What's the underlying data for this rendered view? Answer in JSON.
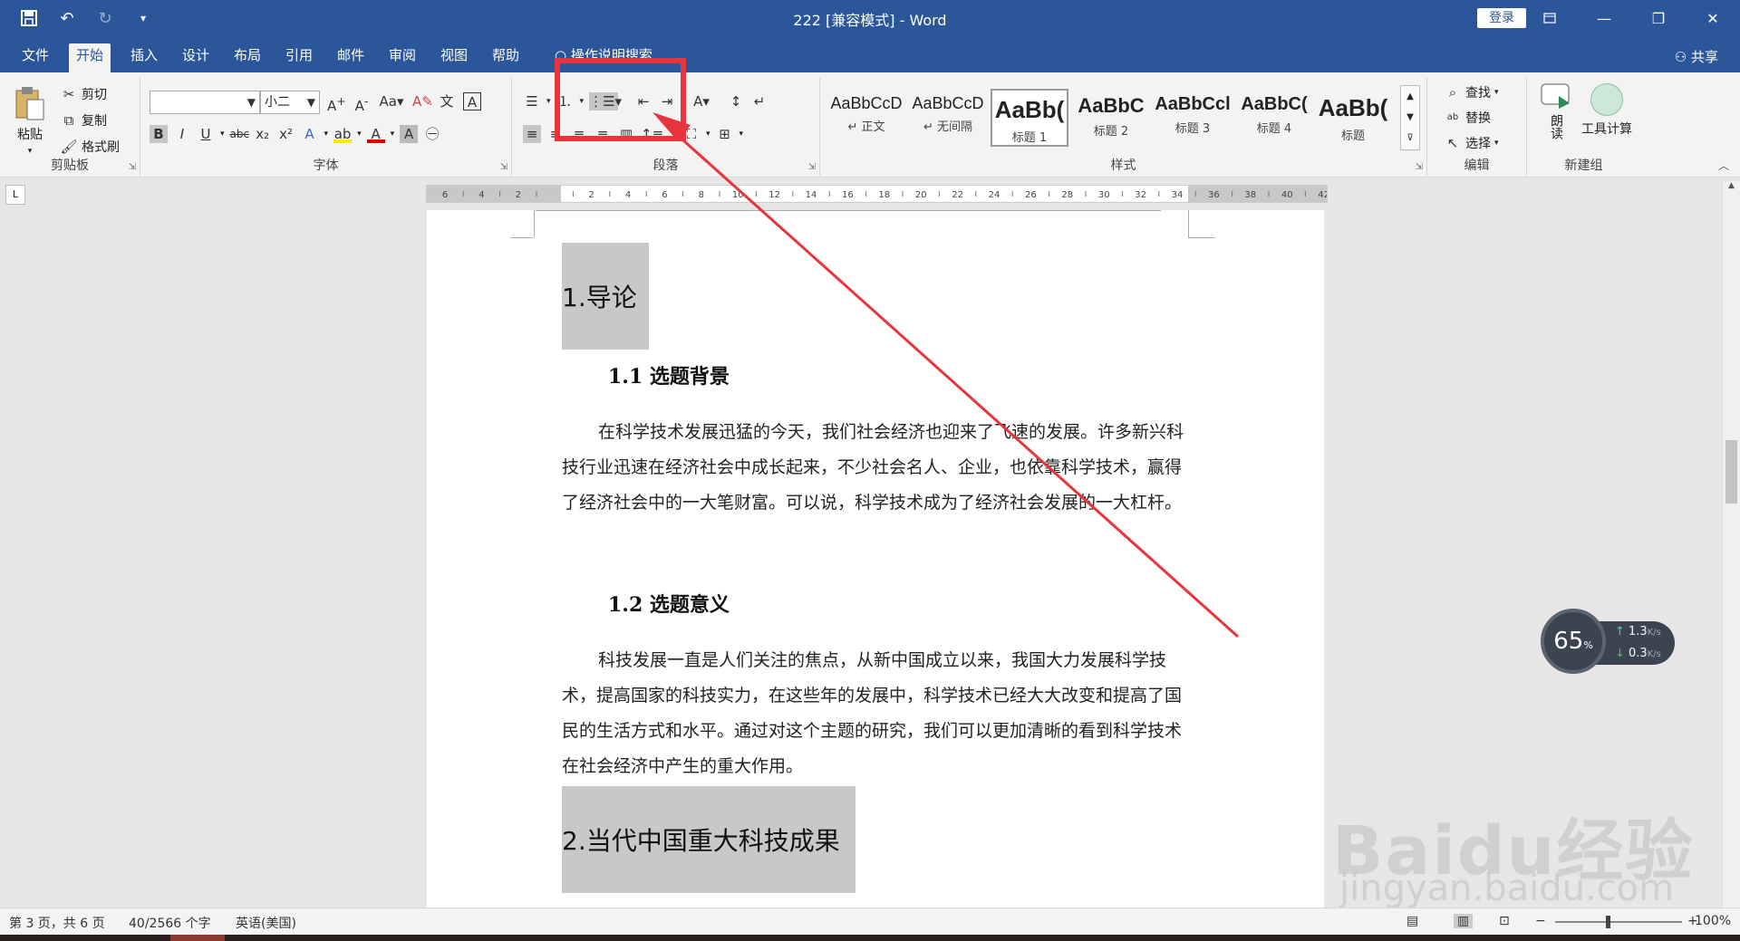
{
  "window": {
    "title": "222 [兼容模式]  -  Word",
    "login_label": "登录",
    "controls": [
      "restore-ribbon-icon",
      "minimize-icon",
      "maximize-icon",
      "close-icon"
    ]
  },
  "tabs": [
    {
      "label": "文件"
    },
    {
      "label": "开始",
      "active": true
    },
    {
      "label": "插入"
    },
    {
      "label": "设计"
    },
    {
      "label": "布局"
    },
    {
      "label": "引用"
    },
    {
      "label": "邮件"
    },
    {
      "label": "审阅"
    },
    {
      "label": "视图"
    },
    {
      "label": "帮助"
    },
    {
      "label": "操作说明搜索"
    }
  ],
  "share_label": "共享",
  "clipboard": {
    "label": "剪贴板",
    "paste": "粘贴",
    "cut": "剪切",
    "copy": "复制",
    "format_painter": "格式刷"
  },
  "font": {
    "label": "字体",
    "font_name": "",
    "font_size": "小二"
  },
  "paragraph": {
    "label": "段落"
  },
  "styles": {
    "label": "样式",
    "items": [
      {
        "sample": "AaBbCcD",
        "name": "↵ 正文"
      },
      {
        "sample": "AaBbCcD",
        "name": "↵ 无间隔"
      },
      {
        "sample": "AaBb(",
        "name": "标题 1",
        "selected": true
      },
      {
        "sample": "AaBbC",
        "name": "标题 2"
      },
      {
        "sample": "AaBbCcl",
        "name": "标题 3"
      },
      {
        "sample": "AaBbC(",
        "name": "标题 4"
      },
      {
        "sample": "AaBb(",
        "name": "标题"
      }
    ]
  },
  "editing": {
    "label": "编辑",
    "find": "查找",
    "replace": "替换",
    "select": "选择"
  },
  "new_group": {
    "label": "新建组",
    "read": "朗读",
    "tool": "工具计算"
  },
  "ruler": {
    "labels": [
      "6",
      "4",
      "2",
      "",
      "2",
      "4",
      "6",
      "8",
      "10",
      "12",
      "14",
      "16",
      "18",
      "20",
      "22",
      "24",
      "26",
      "28",
      "30",
      "32",
      "34",
      "36",
      "38",
      "40",
      "42"
    ]
  },
  "document": {
    "h1_a": "1.导论",
    "h2_a": "1.1 选题背景",
    "p1": "在科学技术发展迅猛的今天，我们社会经济也迎来了飞速的发展。许多新兴科技行业迅速在经济社会中成长起来，不少社会名人、企业，也依靠科学技术，赢得了经济社会中的一大笔财富。可以说，科学技术成为了经济社会发展的一大杠杆。",
    "h2_b": "1.2 选题意义",
    "p2": "科技发展一直是人们关注的焦点，从新中国成立以来，我国大力发展科学技术，提高国家的科技实力，在这些年的发展中，科学技术已经大大改变和提高了国民的生活方式和水平。通过对这个主题的研究，我们可以更加清晰的看到科学技术在社会经济中产生的重大作用。",
    "h1_b": "2.当代中国重大科技成果"
  },
  "status": {
    "page": "第 3 页，共 6 页",
    "words": "40/2566 个字",
    "language": "英语(美国)",
    "zoom": "100%"
  },
  "net_widget": {
    "percent": "65",
    "percent_unit": "%",
    "up": "1.3",
    "down": "0.3",
    "unit": "K/s"
  },
  "watermark": {
    "text": "Baidu经验",
    "url": "jingyan.baidu.com"
  },
  "colors": {
    "word_blue": "#2b579a",
    "highlight_red": "#e8353b",
    "heading_shade": "#c8c8c8"
  }
}
